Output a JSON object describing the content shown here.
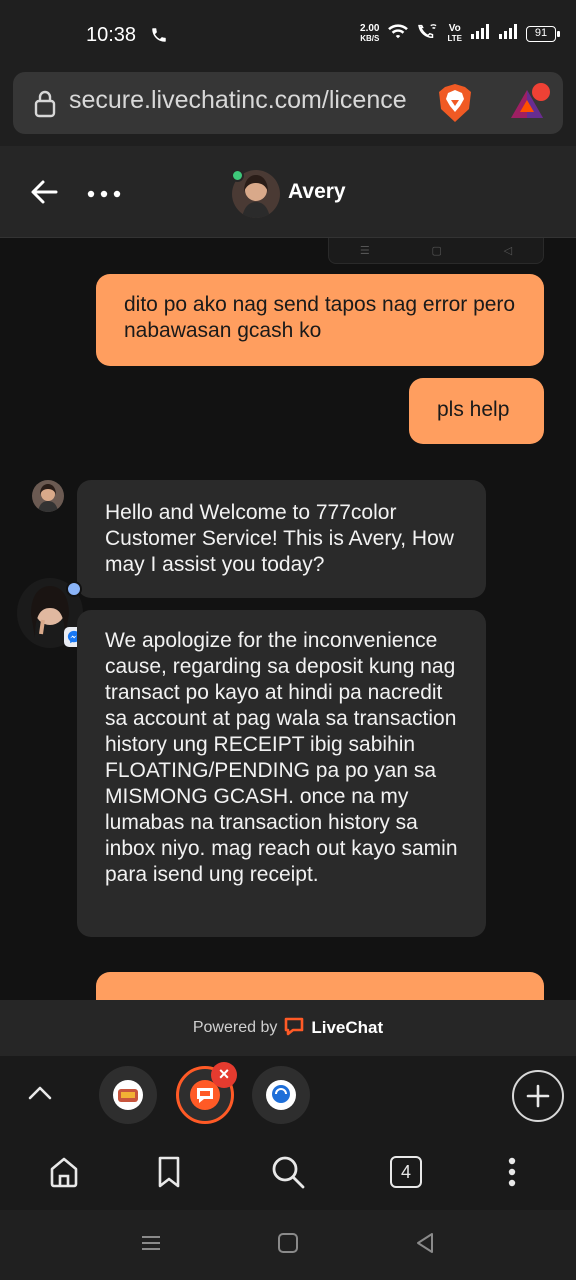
{
  "status_bar": {
    "time": "10:38",
    "net_speed_value": "2.00",
    "net_speed_unit": "KB/S",
    "volte_label_top": "Vo",
    "volte_label_bottom": "LTE",
    "battery": "91"
  },
  "browser": {
    "url": "secure.livechatinc.com/licence"
  },
  "chat_header": {
    "agent_name": "Avery",
    "online": true
  },
  "messages": [
    {
      "from": "user",
      "text": "dito po ako nag send tapos nag error pero nabawasan gcash ko"
    },
    {
      "from": "user",
      "text": "pls help"
    },
    {
      "from": "agent",
      "text": "Hello and Welcome to 777color Customer Service! This is Avery, How may I assist you today?"
    },
    {
      "from": "agent",
      "text": "We apologize for the inconvenience cause, regarding sa deposit kung nag transact po kayo at hindi pa nacredit sa account at pag wala sa transaction history ung RECEIPT ibig sabihin FLOATING/PENDING pa po yan sa MISMONG GCASH. once na my lumabas na transaction history sa inbox niyo. mag reach out kayo samin para isend ung receipt."
    }
  ],
  "footer": {
    "powered_by": "Powered by",
    "brand": "LiveChat"
  },
  "tabs": {
    "count": "4",
    "close_glyph": "×"
  },
  "colors": {
    "user_bubble": "#ff9e5f",
    "agent_bubble": "#2a2a2a",
    "livechat_orange": "#ff5a26",
    "online_green": "#3ec87a"
  },
  "icons": [
    "phone-icon",
    "wifi-icon",
    "call-wifi-icon",
    "signal-icon",
    "battery-icon",
    "lock-icon",
    "brave-lion-icon",
    "bat-triangle-icon",
    "back-arrow-icon",
    "more-icon",
    "messenger-icon",
    "livechat-logo-icon",
    "chevron-up-icon",
    "plus-icon",
    "home-icon",
    "bookmark-icon",
    "search-icon",
    "menu-dots-icon",
    "nav-recents-icon",
    "nav-home-icon",
    "nav-back-icon"
  ]
}
